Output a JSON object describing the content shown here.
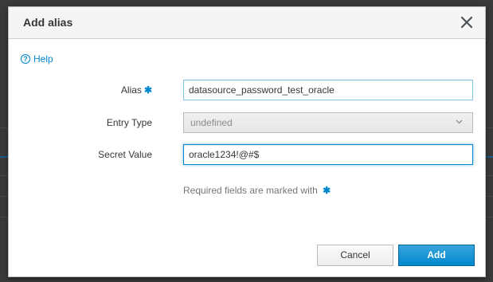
{
  "modal": {
    "title": "Add alias",
    "help_label": "Help",
    "fields": {
      "alias": {
        "label": "Alias",
        "value": "datasource_password_test_oracle"
      },
      "entry_type": {
        "label": "Entry Type",
        "value": "undefined"
      },
      "secret_value": {
        "label": "Secret Value",
        "value": "oracle1234!@#$"
      }
    },
    "required_note": "Required fields are marked with",
    "required_marker": "✱",
    "buttons": {
      "cancel": "Cancel",
      "add": "Add"
    }
  },
  "colors": {
    "accent": "#0088ce",
    "primary_button": "#0088ce",
    "header_bg": "#f5f5f5"
  },
  "icons": [
    "close-icon",
    "help-icon",
    "chevron-down-icon"
  ]
}
